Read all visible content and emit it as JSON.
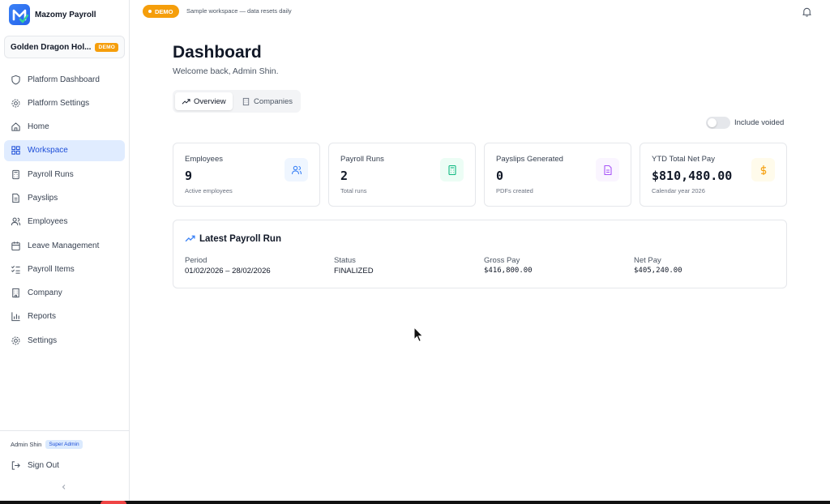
{
  "app": {
    "name": "Mazomy Payroll"
  },
  "workspace": {
    "name": "Golden Dragon Hol...",
    "badge": "DEMO"
  },
  "nav": [
    {
      "label": "Platform Dashboard",
      "icon": "shield-icon"
    },
    {
      "label": "Platform Settings",
      "icon": "gear-icon"
    },
    {
      "label": "Home",
      "icon": "home-icon"
    },
    {
      "label": "Workspace",
      "icon": "grid-icon",
      "active": true
    },
    {
      "label": "Payroll Runs",
      "icon": "calculator-icon"
    },
    {
      "label": "Payslips",
      "icon": "file-icon"
    },
    {
      "label": "Employees",
      "icon": "users-icon"
    },
    {
      "label": "Leave Management",
      "icon": "calendar-icon"
    },
    {
      "label": "Payroll Items",
      "icon": "list-check-icon"
    },
    {
      "label": "Company",
      "icon": "building-icon"
    },
    {
      "label": "Reports",
      "icon": "bar-chart-icon"
    },
    {
      "label": "Settings",
      "icon": "gear-icon"
    }
  ],
  "user": {
    "name": "Admin Shin",
    "role": "Super Admin",
    "signout": "Sign Out"
  },
  "topbar": {
    "badge": "DEMO",
    "message": "Sample workspace — data resets daily"
  },
  "page": {
    "title": "Dashboard",
    "subtitle": "Welcome back, Admin Shin.",
    "tabs": [
      {
        "label": "Overview"
      },
      {
        "label": "Companies"
      }
    ],
    "toggle_label": "Include voided"
  },
  "stats": [
    {
      "label": "Employees",
      "value": "9",
      "sub": "Active employees",
      "icon": "users-icon",
      "color": "#3b82f6",
      "bg": "#eff6ff"
    },
    {
      "label": "Payroll Runs",
      "value": "2",
      "sub": "Total runs",
      "icon": "calculator-icon",
      "color": "#10b981",
      "bg": "#ecfdf5"
    },
    {
      "label": "Payslips Generated",
      "value": "0",
      "sub": "PDFs created",
      "icon": "file-icon",
      "color": "#a855f7",
      "bg": "#faf5ff"
    },
    {
      "label": "YTD Total Net Pay",
      "value": "$810,480.00",
      "sub": "Calendar year 2026",
      "icon": "dollar-icon",
      "color": "#f59e0b",
      "bg": "#fffbeb"
    }
  ],
  "latest": {
    "title": "Latest Payroll Run",
    "period_label": "Period",
    "period": "01/02/2026 – 28/02/2026",
    "status_label": "Status",
    "status": "FINALIZED",
    "gross_label": "Gross Pay",
    "gross": "$416,800.00",
    "net_label": "Net Pay",
    "net": "$405,240.00"
  }
}
